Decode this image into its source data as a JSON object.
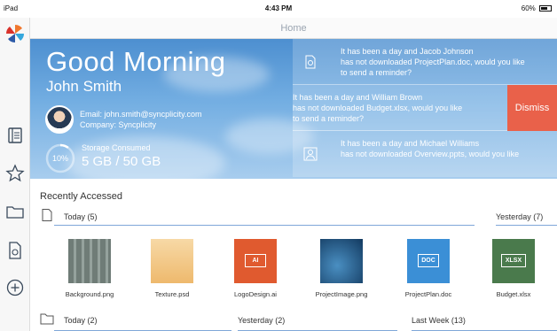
{
  "status_bar": {
    "device": "iPad",
    "time": "4:43 PM",
    "battery": "60%"
  },
  "nav": {
    "title": "Home"
  },
  "sidebar": {
    "items": [
      {
        "name": "recent",
        "icon": "book-icon"
      },
      {
        "name": "favorites",
        "icon": "star-icon"
      },
      {
        "name": "folders",
        "icon": "folder-icon"
      },
      {
        "name": "shared",
        "icon": "shared-file-icon"
      },
      {
        "name": "add",
        "icon": "plus-circle-icon"
      }
    ]
  },
  "hero": {
    "greeting": "Good Morning",
    "user_name": "John Smith",
    "email": "Email: john.smith@syncplicity.com",
    "company": "Company: Syncplicity",
    "storage_percent": 10,
    "storage_percent_label": "10%",
    "storage_label": "Storage Consumed",
    "storage_value": "5 GB / 50 GB"
  },
  "notifications": [
    {
      "text": "It has been a day and Jacob Johnson has not downloaded ProjectPlan.doc, would you like to send a reminder?",
      "line1": "It has been a day and Jacob Johnson",
      "line2": "has not downloaded ProjectPlan.doc, would you like",
      "line3": "to send a reminder?"
    },
    {
      "line1": "It has been a day and William Brown",
      "line2": "has not downloaded Budget.xlsx, would you like",
      "line3": "to send a reminder?",
      "action": "Dismiss"
    },
    {
      "line1": "It has been a day and Michael Williams",
      "line2": "has not downloaded Overview.ppts, would you like",
      "line3": ""
    }
  ],
  "recent": {
    "title": "Recently Accessed",
    "groups": [
      {
        "label": "Today (5)"
      },
      {
        "label": "Yesterday (7)"
      }
    ],
    "files": [
      {
        "name": "Background.png",
        "type": "image",
        "color": "#7d8a84"
      },
      {
        "name": "Texture.psd",
        "type": "image",
        "color": "#f2c98a"
      },
      {
        "name": "LogoDesign.ai",
        "type": "ai",
        "badge": "AI",
        "color": "#e05a2f"
      },
      {
        "name": "ProjectImage.png",
        "type": "image",
        "color": "#1f5f93"
      },
      {
        "name": "ProjectPlan.doc",
        "type": "doc",
        "badge": "DOC",
        "color": "#3b8fd6"
      },
      {
        "name": "Budget.xlsx",
        "type": "xlsx",
        "badge": "XLSX",
        "color": "#4a7a4c"
      }
    ],
    "bottom_groups": [
      {
        "label": "Today (2)"
      },
      {
        "label": "Yesterday (2)"
      },
      {
        "label": "Last Week (13)"
      }
    ]
  },
  "colors": {
    "accent": "#7fa7d8",
    "dismiss": "#e9614a",
    "hero_sky": "#5f9fdc"
  }
}
